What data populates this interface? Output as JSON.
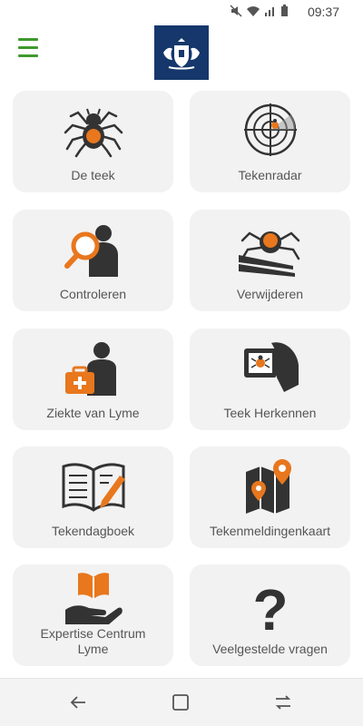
{
  "status": {
    "time": "09:37"
  },
  "tiles": [
    {
      "label": "De teek"
    },
    {
      "label": "Tekenradar"
    },
    {
      "label": "Controleren"
    },
    {
      "label": "Verwijderen"
    },
    {
      "label": "Ziekte van Lyme"
    },
    {
      "label": "Teek Herkennen"
    },
    {
      "label": "Tekendagboek"
    },
    {
      "label": "Tekenmeldingenkaart"
    },
    {
      "label": "Expertise Centrum\nLyme"
    },
    {
      "label": "Veelgestelde vragen"
    }
  ],
  "colors": {
    "accent": "#e8771d",
    "icon_dark": "#333333",
    "menu_green": "#3f9a2d",
    "logo_blue": "#15376b"
  }
}
